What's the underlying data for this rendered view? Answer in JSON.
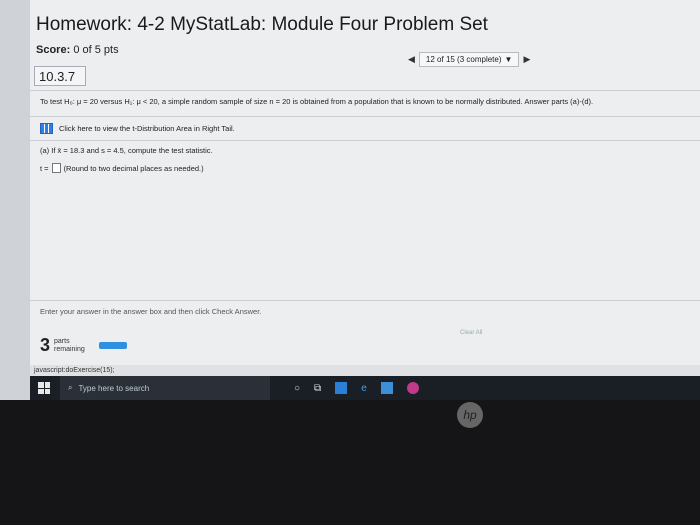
{
  "header": {
    "title": "Homework: 4-2 MyStatLab: Module Four Problem Set",
    "score_label": "Score:",
    "score_value": "0 of 5 pts"
  },
  "navigation": {
    "position": "12 of 15 (3 complete)"
  },
  "question": {
    "section": "10.3.7",
    "prompt": "To test H₀: μ = 20 versus H₁: μ < 20, a simple random sample of size n = 20 is obtained from a population that is known to be normally distributed. Answer parts (a)-(d).",
    "table_link": "Click here to view the t-Distribution Area in Right Tail.",
    "part_a": "(a) If x̄ = 18.3 and s = 4.5, compute the test statistic.",
    "answer_prefix": "t =",
    "answer_hint": "(Round to two decimal places as needed.)",
    "instructions": "Enter your answer in the answer box and then click Check Answer.",
    "clear_all": "Clear All",
    "parts_count": "3",
    "parts_label_1": "parts",
    "parts_label_2": "remaining"
  },
  "status_bar": "javascript:doExercise(15);",
  "taskbar": {
    "search_placeholder": "Type here to search"
  },
  "brand": "hp",
  "colors": {
    "accent_blue": "#2f8fe0",
    "taskbar": "#1a1f26"
  }
}
